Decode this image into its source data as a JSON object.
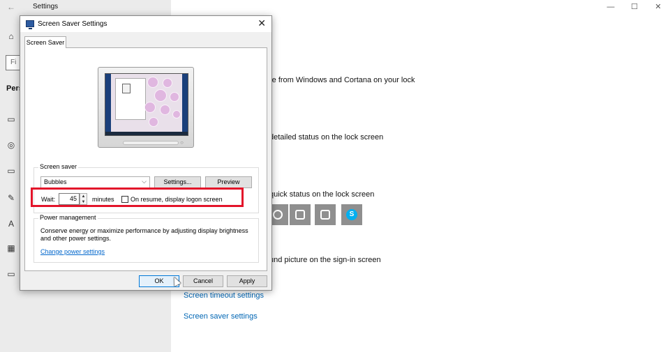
{
  "settings": {
    "title": "Settings",
    "back_icon": "back-arrow-icon",
    "find_placeholder": "Fi",
    "section_label": "Pers",
    "window_controls": {
      "minimize": "—",
      "maximize": "☐",
      "close": "✕"
    },
    "nav_icons": [
      "home-icon",
      "picture-icon",
      "palette-icon",
      "taskbar-icon",
      "theme-icon",
      "font-icon",
      "start-icon",
      "screen-icon"
    ]
  },
  "background_content": {
    "line1": "re from Windows and Cortana on your lock",
    "line2": "detailed status on the lock screen",
    "line3": "quick status on the lock screen",
    "line4": "und picture on the sign-in screen",
    "link_timeout": "Screen timeout settings",
    "link_screensaver": "Screen saver settings",
    "app_icons": [
      "edge-icon",
      "calendar-icon",
      "store-icon",
      "skype-icon"
    ],
    "skype_letter": "S"
  },
  "dialog": {
    "title": "Screen Saver Settings",
    "close": "✕",
    "tab": "Screen Saver",
    "screen_saver_group": "Screen saver",
    "selected_saver": "Bubbles",
    "settings_button": "Settings...",
    "preview_button": "Preview",
    "wait_label": "Wait:",
    "wait_value": "45",
    "minutes_label": "minutes",
    "resume_label": "On resume, display logon screen",
    "resume_checked": false,
    "power_group": "Power management",
    "power_text": "Conserve energy or maximize performance by adjusting display brightness and other power settings.",
    "power_link": "Change power settings",
    "ok_button": "OK",
    "cancel_button": "Cancel",
    "apply_button": "Apply"
  },
  "colors": {
    "highlight": "#e3142a",
    "link": "#0066b4",
    "accent": "#0078d7"
  }
}
